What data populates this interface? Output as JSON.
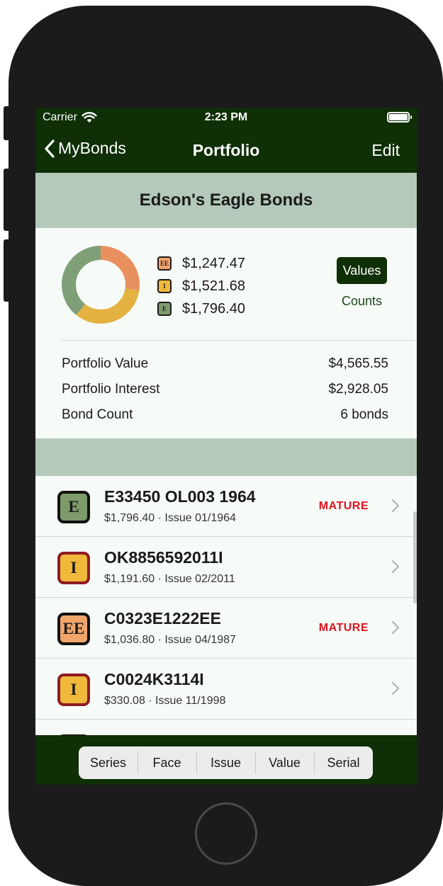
{
  "status": {
    "carrier": "Carrier",
    "time": "2:23 PM"
  },
  "nav": {
    "back_label": "MyBonds",
    "title": "Portfolio",
    "edit_label": "Edit"
  },
  "portfolio": {
    "name": "Edson's Eagle Bonds"
  },
  "chart_data": {
    "type": "pie",
    "style": "donut",
    "categories": [
      "EE",
      "I",
      "E"
    ],
    "values": [
      1247.47,
      1521.68,
      1796.4
    ],
    "value_labels": [
      "$1,247.47",
      "$1,521.68",
      "$1,796.40"
    ],
    "colors": [
      "#e8915f",
      "#e3b240",
      "#7f9f77"
    ]
  },
  "legend": [
    {
      "badge": "EE",
      "color": "#f1a56b",
      "value": "$1,247.47"
    },
    {
      "badge": "I",
      "color": "#f0b93b",
      "value": "$1,521.68"
    },
    {
      "badge": "E",
      "color": "#7e9b6c",
      "value": "$1,796.40"
    }
  ],
  "toggle": {
    "values_label": "Values",
    "counts_label": "Counts",
    "selected": "Values"
  },
  "stats": [
    {
      "label": "Portfolio Value",
      "value": "$4,565.55"
    },
    {
      "label": "Portfolio Interest",
      "value": "$2,928.05"
    },
    {
      "label": "Bond Count",
      "value": "6 bonds"
    }
  ],
  "bonds": [
    {
      "series": "E",
      "serial": "E33450 OL003 1964",
      "detail": "$1,796.40 · Issue 01/1964",
      "status": "MATURE",
      "badge_color": "#7e9b6c",
      "rim": "dark"
    },
    {
      "series": "I",
      "serial": "OK8856592011I",
      "detail": "$1,191.60 · Issue 02/2011",
      "status": "",
      "badge_color": "#f0b93b",
      "rim": "red"
    },
    {
      "series": "EE",
      "serial": "C0323E1222EE",
      "detail": "$1,036.80 · Issue 04/1987",
      "status": "MATURE",
      "badge_color": "#f1a56b",
      "rim": "dark"
    },
    {
      "series": "I",
      "serial": "C0024K3114I",
      "detail": "$330.08 · Issue 11/1998",
      "status": "",
      "badge_color": "#f0b93b",
      "rim": "red"
    }
  ],
  "sort_options": [
    "Series",
    "Face",
    "Issue",
    "Value",
    "Serial"
  ],
  "colors": {
    "bar": "#0f2f06",
    "band": "#b4c9b9",
    "mature": "#e0141d"
  }
}
